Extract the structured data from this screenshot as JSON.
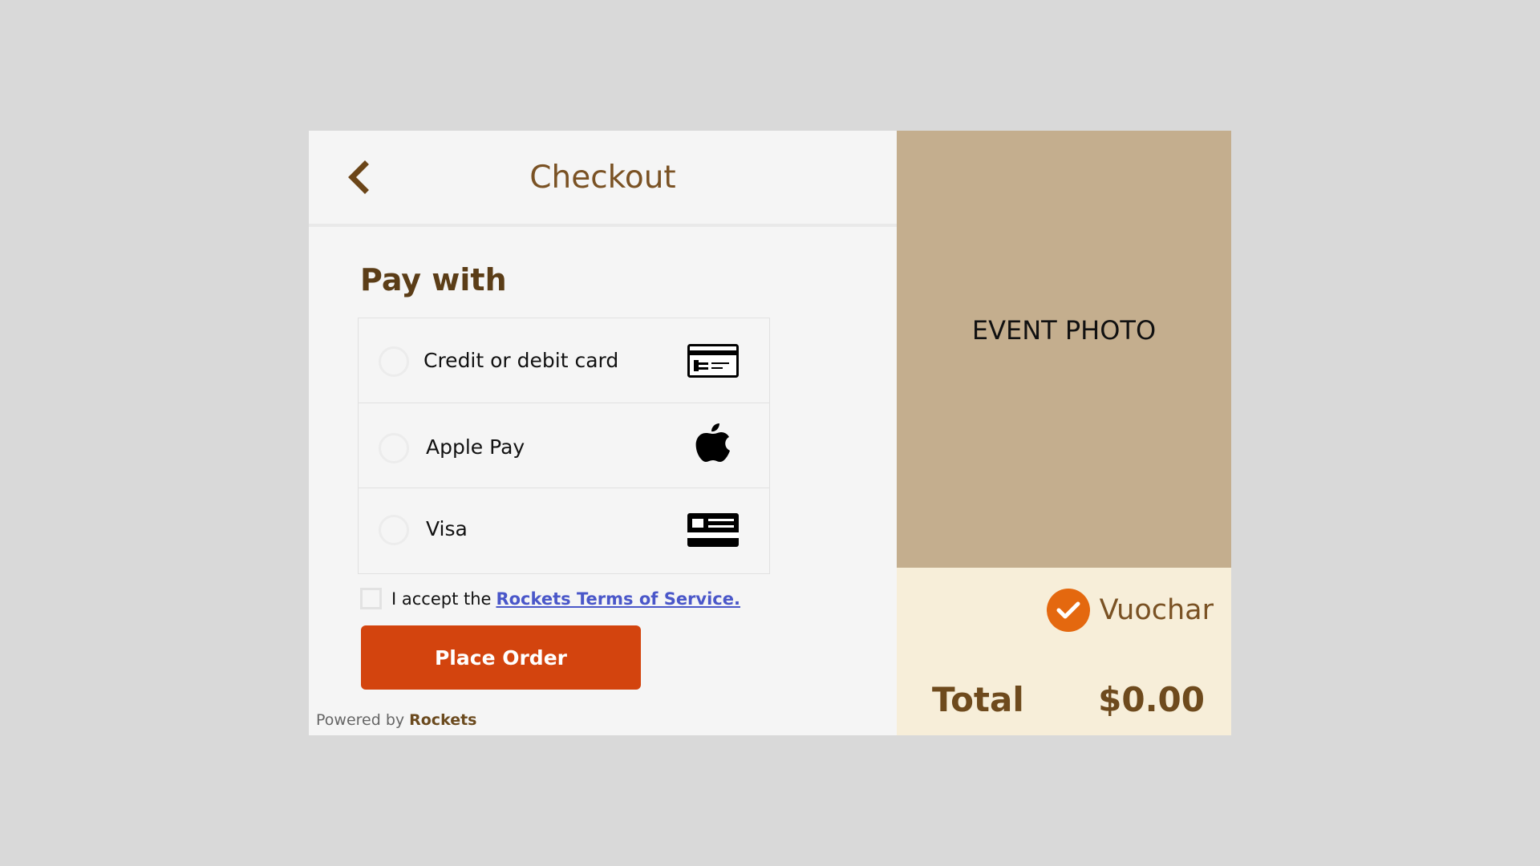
{
  "header": {
    "title": "Checkout",
    "back_icon": "chevron-left-icon"
  },
  "payment": {
    "heading": "Pay with",
    "options": [
      {
        "label": "Credit or debit card",
        "icon": "credit-card-icon"
      },
      {
        "label": "Apple Pay",
        "icon": "apple-icon"
      },
      {
        "label": "Visa",
        "icon": "id-card-icon"
      }
    ]
  },
  "terms": {
    "prefix": "I accept the",
    "link": "Rockets Terms of Service."
  },
  "actions": {
    "place_order": "Place Order"
  },
  "footer": {
    "powered_by": "Powered by",
    "brand": "Rockets"
  },
  "event": {
    "photo_label": "EVENT PHOTO"
  },
  "summary": {
    "voucher_label": "Vuochar",
    "total_label": "Total",
    "total_value": "$0.00"
  },
  "colors": {
    "accent": "#d3440e",
    "brand_brown": "#7a5224",
    "voucher_orange": "#e4680f",
    "link_blue": "#4a57c9"
  }
}
